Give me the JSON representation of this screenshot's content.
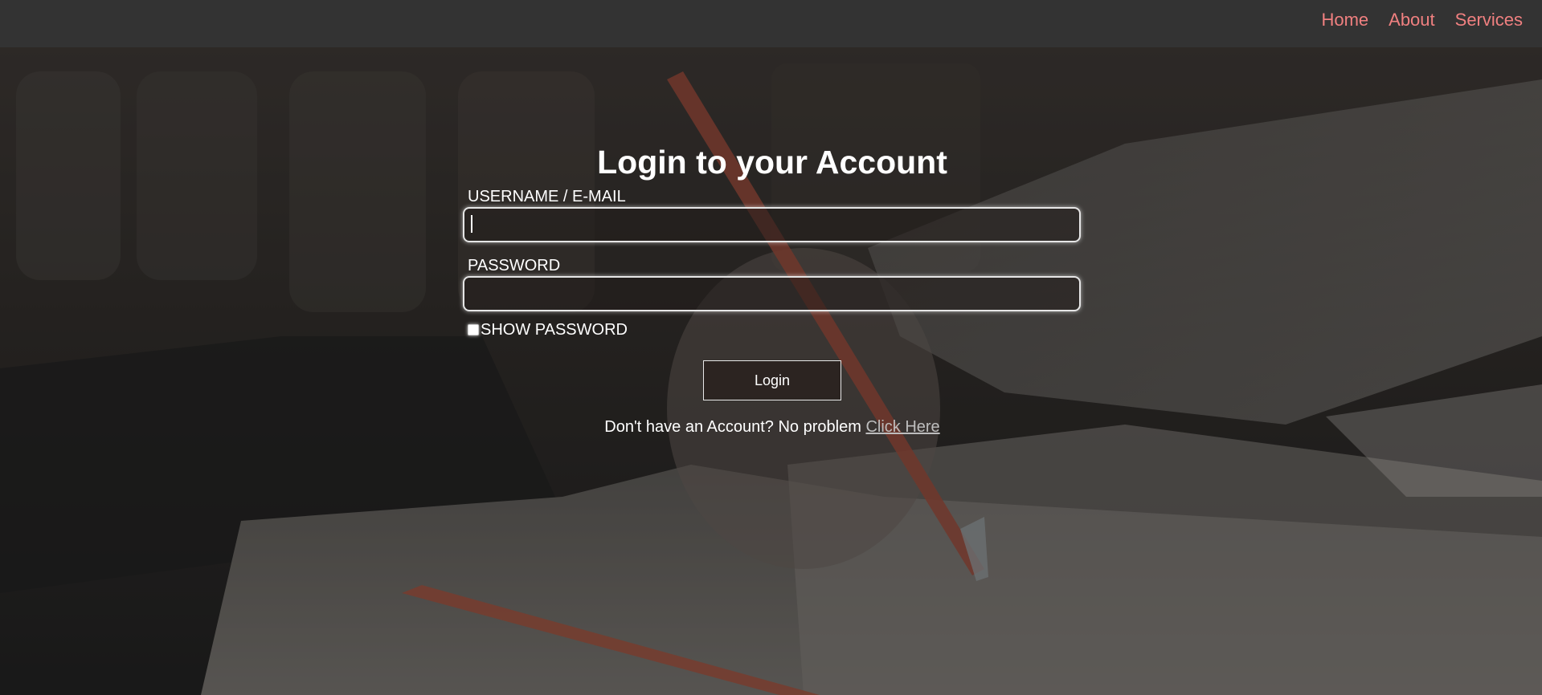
{
  "nav": {
    "links": [
      {
        "label": "Home"
      },
      {
        "label": "About"
      },
      {
        "label": "Services"
      }
    ]
  },
  "login": {
    "title": "Login to your Account",
    "username_label": "USERNAME / E-MAIL",
    "username_value": "",
    "password_label": "PASSWORD",
    "password_value": "",
    "show_password_label": "SHOW PASSWORD",
    "show_password_checked": false,
    "submit_label": "Login",
    "signup_prompt": "Don't have an Account? No problem",
    "signup_link": "Click Here"
  },
  "colors": {
    "navbar_bg": "#333333",
    "nav_link": "#f08080",
    "text": "#ffffff",
    "link_muted": "#bdbdbd"
  },
  "icons": {
    "checkbox": "checkbox-unchecked"
  }
}
